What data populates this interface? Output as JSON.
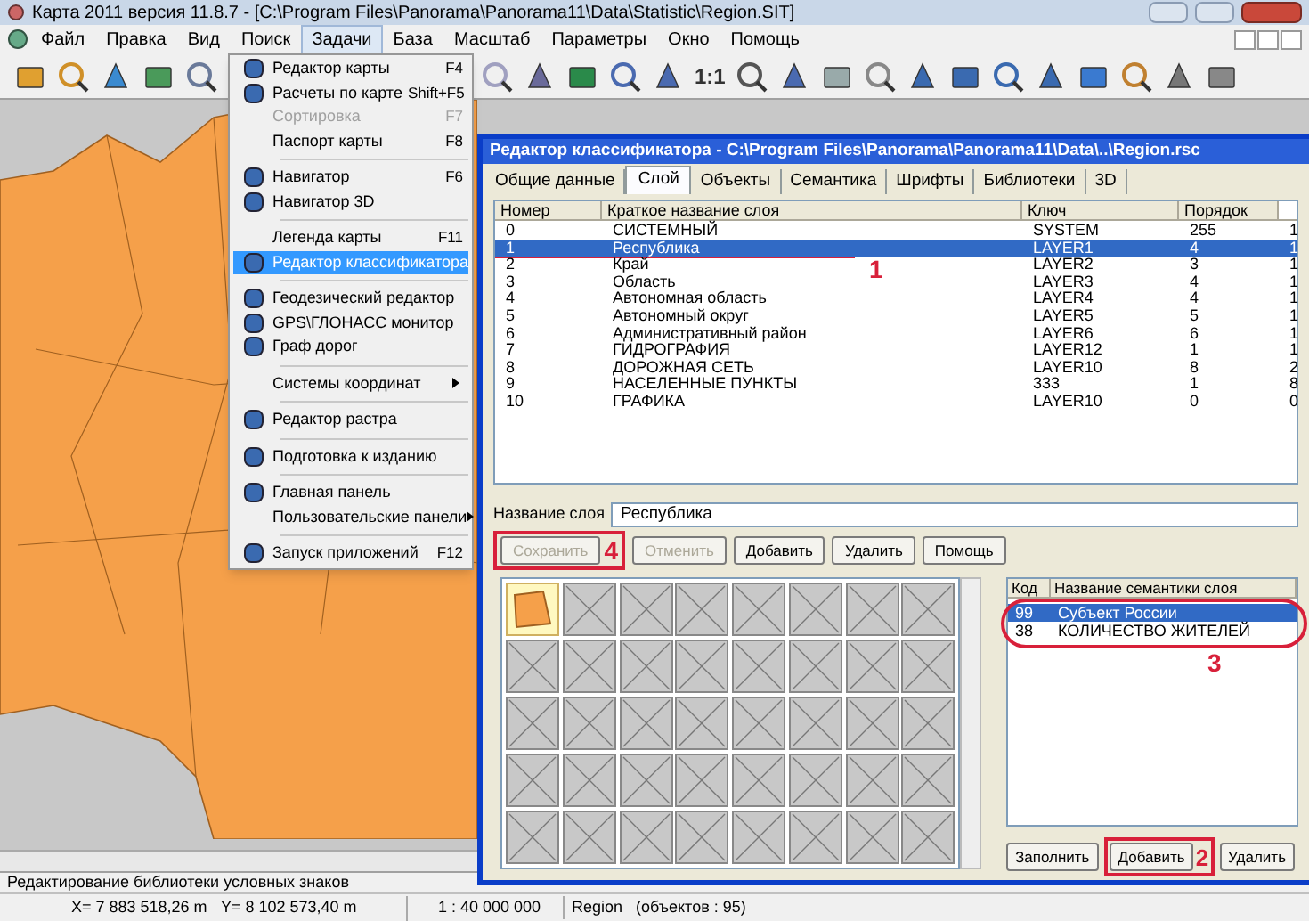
{
  "window": {
    "title": "Карта 2011 версия 11.8.7 - [C:\\Program Files\\Panorama\\Panorama11\\Data\\Statistic\\Region.SIT]"
  },
  "menu_bar": [
    {
      "label": "Файл",
      "selected": false
    },
    {
      "label": "Правка",
      "selected": false
    },
    {
      "label": "Вид",
      "selected": false
    },
    {
      "label": "Поиск",
      "selected": false
    },
    {
      "label": "Задачи",
      "selected": true
    },
    {
      "label": "База",
      "selected": false
    },
    {
      "label": "Масштаб",
      "selected": false
    },
    {
      "label": "Параметры",
      "selected": false
    },
    {
      "label": "Окно",
      "selected": false
    },
    {
      "label": "Помощь",
      "selected": false
    }
  ],
  "toolbar": {
    "scale_button": "1:1"
  },
  "menu": [
    {
      "kind": "item",
      "label": "Редактор карты",
      "shortcut": "F4",
      "icon": true,
      "disabled": false,
      "selected": false
    },
    {
      "kind": "item",
      "label": "Расчеты по карте",
      "shortcut": "Shift+F5",
      "icon": true,
      "disabled": false,
      "selected": false
    },
    {
      "kind": "item",
      "label": "Сортировка",
      "shortcut": "F7",
      "icon": false,
      "disabled": true,
      "selected": false
    },
    {
      "kind": "item",
      "label": "Паспорт карты",
      "shortcut": "F8",
      "icon": false,
      "disabled": false,
      "selected": false
    },
    {
      "kind": "separator"
    },
    {
      "kind": "item",
      "label": "Навигатор",
      "shortcut": "F6",
      "icon": true,
      "disabled": false,
      "selected": false
    },
    {
      "kind": "item",
      "label": "Навигатор 3D",
      "icon": true,
      "disabled": false,
      "selected": false
    },
    {
      "kind": "separator"
    },
    {
      "kind": "item",
      "label": "Легенда карты",
      "shortcut": "F11",
      "icon": false,
      "disabled": false,
      "selected": false
    },
    {
      "kind": "item",
      "label": "Редактор классификатора",
      "icon": true,
      "disabled": false,
      "selected": true
    },
    {
      "kind": "separator"
    },
    {
      "kind": "item",
      "label": "Геодезический редактор",
      "icon": true,
      "disabled": false,
      "selected": false
    },
    {
      "kind": "item",
      "label": "GPS\\ГЛОНАСС монитор",
      "icon": true,
      "disabled": false,
      "selected": false
    },
    {
      "kind": "item",
      "label": "Граф дорог",
      "icon": true,
      "disabled": false,
      "selected": false
    },
    {
      "kind": "separator"
    },
    {
      "kind": "item",
      "label": "Системы координат",
      "submenu": true,
      "icon": false,
      "disabled": false,
      "selected": false
    },
    {
      "kind": "separator"
    },
    {
      "kind": "item",
      "label": "Редактор растра",
      "icon": true,
      "disabled": false,
      "selected": false
    },
    {
      "kind": "separator"
    },
    {
      "kind": "item",
      "label": "Подготовка к изданию",
      "icon": true,
      "disabled": false,
      "selected": false
    },
    {
      "kind": "separator"
    },
    {
      "kind": "item",
      "label": "Главная панель",
      "icon": true,
      "disabled": false,
      "selected": false
    },
    {
      "kind": "item",
      "label": "Пользовательские панели",
      "submenu": true,
      "icon": false,
      "disabled": false,
      "selected": false
    },
    {
      "kind": "separator"
    },
    {
      "kind": "item",
      "label": "Запуск приложений",
      "shortcut": "F12",
      "icon": true,
      "disabled": false,
      "selected": false
    }
  ],
  "dialog": {
    "title": "Редактор классификатора - C:\\Program Files\\Panorama\\Panorama11\\Data\\..\\Region.rsc",
    "tabs": [
      {
        "label": "Общие данные",
        "selected": false
      },
      {
        "label": "Слой",
        "selected": true
      },
      {
        "label": "Объекты",
        "selected": false
      },
      {
        "label": "Семантика",
        "selected": false
      },
      {
        "label": "Шрифты",
        "selected": false
      },
      {
        "label": "Библиотеки",
        "selected": false
      },
      {
        "label": "3D",
        "selected": false
      }
    ],
    "layers_table": {
      "columns": [
        "Номер",
        "Краткое название слоя",
        "Ключ",
        "Порядок"
      ],
      "rows": [
        {
          "cells": [
            "0",
            "СИСТЕМНЫЙ",
            "SYSTEM",
            "255",
            "1"
          ],
          "selected": false
        },
        {
          "cells": [
            "1",
            "Республика",
            "LAYER1",
            "4",
            "1"
          ],
          "selected": true
        },
        {
          "cells": [
            "2",
            "Край",
            "LAYER2",
            "3",
            "1"
          ],
          "selected": false
        },
        {
          "cells": [
            "3",
            "Область",
            "LAYER3",
            "4",
            "1"
          ],
          "selected": false
        },
        {
          "cells": [
            "4",
            "Автономная область",
            "LAYER4",
            "4",
            "1"
          ],
          "selected": false
        },
        {
          "cells": [
            "5",
            "Автономный округ",
            "LAYER5",
            "5",
            "1"
          ],
          "selected": false
        },
        {
          "cells": [
            "6",
            "Административный район",
            "LAYER6",
            "6",
            "1"
          ],
          "selected": false
        },
        {
          "cells": [
            "7",
            "ГИДРОГРАФИЯ",
            "LAYER12",
            "1",
            "1"
          ],
          "selected": false
        },
        {
          "cells": [
            "8",
            "ДОРОЖНАЯ СЕТЬ",
            "LAYER10",
            "8",
            "2"
          ],
          "selected": false
        },
        {
          "cells": [
            "9",
            "НАСЕЛЕННЫЕ ПУНКТЫ",
            "333",
            "1",
            "8"
          ],
          "selected": false
        },
        {
          "cells": [
            "10",
            "ГРАФИКА",
            "LAYER10",
            "0",
            "0"
          ],
          "selected": false
        }
      ]
    },
    "layer_name": {
      "label": "Название слоя",
      "value": "Республика"
    },
    "buttons": [
      {
        "label": "Сохранить",
        "disabled": true
      },
      {
        "label": "Отменить",
        "disabled": true
      },
      {
        "label": "Добавить",
        "disabled": false
      },
      {
        "label": "Удалить",
        "disabled": false
      },
      {
        "label": "Помощь",
        "disabled": false
      }
    ],
    "symbols": [
      {
        "kind": "fill",
        "selected": true
      },
      {
        "kind": "empty",
        "selected": false
      },
      {
        "kind": "empty",
        "selected": false
      },
      {
        "kind": "empty",
        "selected": false
      },
      {
        "kind": "empty",
        "selected": false
      },
      {
        "kind": "empty",
        "selected": false
      },
      {
        "kind": "empty",
        "selected": false
      },
      {
        "kind": "empty",
        "selected": false
      },
      {
        "kind": "empty",
        "selected": false
      },
      {
        "kind": "empty",
        "selected": false
      },
      {
        "kind": "empty",
        "selected": false
      },
      {
        "kind": "empty",
        "selected": false
      },
      {
        "kind": "empty",
        "selected": false
      },
      {
        "kind": "empty",
        "selected": false
      },
      {
        "kind": "empty",
        "selected": false
      },
      {
        "kind": "empty",
        "selected": false
      },
      {
        "kind": "empty",
        "selected": false
      },
      {
        "kind": "empty",
        "selected": false
      },
      {
        "kind": "empty",
        "selected": false
      },
      {
        "kind": "empty",
        "selected": false
      },
      {
        "kind": "empty",
        "selected": false
      },
      {
        "kind": "empty",
        "selected": false
      },
      {
        "kind": "empty",
        "selected": false
      },
      {
        "kind": "empty",
        "selected": false
      },
      {
        "kind": "empty",
        "selected": false
      },
      {
        "kind": "empty",
        "selected": false
      },
      {
        "kind": "empty",
        "selected": false
      },
      {
        "kind": "empty",
        "selected": false
      },
      {
        "kind": "empty",
        "selected": false
      },
      {
        "kind": "empty",
        "selected": false
      },
      {
        "kind": "empty",
        "selected": false
      },
      {
        "kind": "empty",
        "selected": false
      },
      {
        "kind": "empty",
        "selected": false
      },
      {
        "kind": "empty",
        "selected": false
      },
      {
        "kind": "empty",
        "selected": false
      },
      {
        "kind": "empty",
        "selected": false
      },
      {
        "kind": "empty",
        "selected": false
      },
      {
        "kind": "empty",
        "selected": false
      },
      {
        "kind": "empty",
        "selected": false
      },
      {
        "kind": "empty",
        "selected": false
      }
    ],
    "semantics_table": {
      "columns": [
        "Код",
        "Название семантики слоя"
      ],
      "rows": [
        {
          "cells": [
            "99",
            "Субъект России"
          ],
          "selected": true
        },
        {
          "cells": [
            "38",
            "КОЛИЧЕСТВО ЖИТЕЛЕЙ"
          ],
          "selected": false
        }
      ]
    },
    "semantics_buttons": [
      "Заполнить",
      "Добавить",
      "Удалить"
    ]
  },
  "annotations": [
    "1",
    "4",
    "3",
    "2"
  ],
  "status_bar": {
    "message": "Редактирование библиотеки условных знаков",
    "x": "X= 7 883 518,26 m",
    "y": "Y= 8 102 573,40 m",
    "scale": "1 : 40 000 000",
    "map": "Region   (объектов : 95)"
  }
}
